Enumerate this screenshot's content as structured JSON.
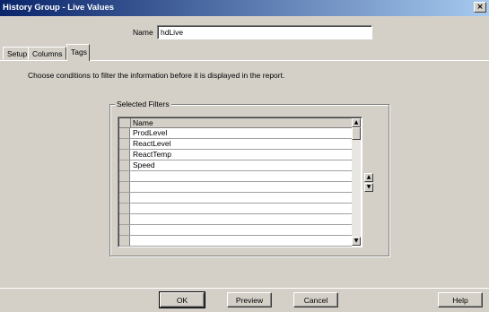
{
  "window": {
    "title": "History Group - Live Values",
    "close_glyph": "×"
  },
  "name_field": {
    "label": "Name",
    "value": "hdLive"
  },
  "tabs": [
    {
      "label": "Setup",
      "active": false
    },
    {
      "label": "Columns",
      "active": false
    },
    {
      "label": "Tags",
      "active": true
    }
  ],
  "instruction": "Choose conditions to filter the information before it is displayed in the report.",
  "filters": {
    "group_title": "Selected Filters",
    "column_header": "Name",
    "rows": [
      "ProdLevel",
      "ReactLevel",
      "ReactTemp",
      "Speed",
      "",
      "",
      "",
      "",
      "",
      "",
      ""
    ]
  },
  "buttons": {
    "ok": "OK",
    "preview": "Preview",
    "cancel": "Cancel",
    "help": "Help"
  },
  "icons": {
    "close": "close-icon",
    "scroll_up": "scroll-up-icon",
    "scroll_down": "scroll-down-icon",
    "move_up": "move-up-icon",
    "move_down": "move-down-icon"
  },
  "colors": {
    "titlebar_start": "#0a246a",
    "titlebar_end": "#a6caf0",
    "face": "#d4d0c8"
  }
}
